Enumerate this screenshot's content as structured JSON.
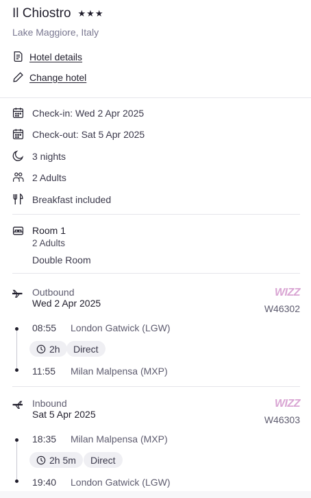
{
  "hotel": {
    "name": "Il Chiostro",
    "stars": "★★★",
    "location": "Lake Maggiore, Italy",
    "details_link": "Hotel details",
    "change_link": "Change hotel"
  },
  "stay": {
    "checkin": "Check-in: Wed 2 Apr 2025",
    "checkout": "Check-out: Sat 5 Apr 2025",
    "nights": "3 nights",
    "guests": "2 Adults",
    "board": "Breakfast included"
  },
  "room": {
    "title": "Room 1",
    "guests": "2 Adults",
    "type": "Double Room"
  },
  "outbound": {
    "label": "Outbound",
    "date": "Wed 2 Apr 2025",
    "airline_logo": "WIZZ",
    "flight_number": "W46302",
    "depart_time": "08:55",
    "depart_airport": "London Gatwick (LGW)",
    "duration": "2h",
    "stops": "Direct",
    "arrive_time": "11:55",
    "arrive_airport": "Milan Malpensa (MXP)"
  },
  "inbound": {
    "label": "Inbound",
    "date": "Sat 5 Apr 2025",
    "airline_logo": "WIZZ",
    "flight_number": "W46303",
    "depart_time": "18:35",
    "depart_airport": "Milan Malpensa (MXP)",
    "duration": "2h 5m",
    "stops": "Direct",
    "arrive_time": "19:40",
    "arrive_airport": "London Gatwick (LGW)"
  },
  "icons": {
    "details": "document-icon",
    "change": "pencil-icon",
    "checkin": "calendar-icon",
    "checkout": "calendar-icon",
    "nights": "moon-icon",
    "guests": "people-icon",
    "board": "cutlery-icon",
    "room": "bed-icon",
    "outbound": "plane-depart-icon",
    "inbound": "plane-arrive-icon",
    "duration": "clock-icon"
  }
}
